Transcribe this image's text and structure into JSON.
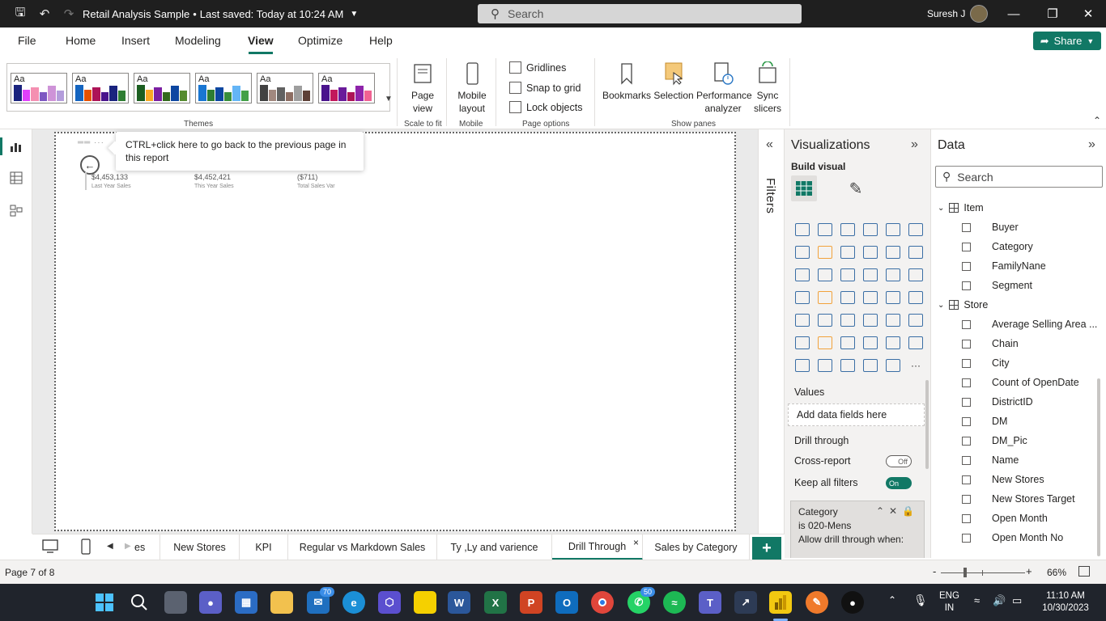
{
  "window": {
    "title": "Retail Analysis Sample",
    "saved_status": "Last saved: Today at 10:24 AM",
    "search_placeholder": "Search",
    "user_name": "Suresh J"
  },
  "menu": {
    "tabs": [
      "File",
      "Home",
      "Insert",
      "Modeling",
      "View",
      "Optimize",
      "Help"
    ],
    "active_tab": "View",
    "share_label": "Share"
  },
  "ribbon": {
    "themes_label": "Themes",
    "theme_aa": "Aa",
    "themes": [
      {
        "colors": [
          "#1a237e",
          "#e040fb",
          "#f48fb1",
          "#7e57c2",
          "#ce93d8",
          "#b39ddb"
        ]
      },
      {
        "colors": [
          "#1565c0",
          "#e65100",
          "#ad1457",
          "#4a148c",
          "#1a237e",
          "#2e7d32"
        ]
      },
      {
        "colors": [
          "#1b5e20",
          "#f9a825",
          "#7b1fa2",
          "#33691e",
          "#0d47a1",
          "#558b2f"
        ]
      },
      {
        "colors": [
          "#1976d2",
          "#2e7d32",
          "#0d47a1",
          "#388e3c",
          "#64b5f6",
          "#43a047"
        ]
      },
      {
        "colors": [
          "#424242",
          "#a1887f",
          "#616161",
          "#8d6e63",
          "#9e9e9e",
          "#5d4037"
        ]
      },
      {
        "colors": [
          "#4a148c",
          "#c2185b",
          "#6a1b9a",
          "#ad1457",
          "#8e24aa",
          "#f06292"
        ]
      }
    ],
    "page_view_label": "Page view",
    "scale_to_fit_label": "Scale to fit",
    "mobile_layout_label": "Mobile layout",
    "mobile_label": "Mobile",
    "gridlines_label": "Gridlines",
    "snap_to_grid_label": "Snap to grid",
    "lock_objects_label": "Lock objects",
    "page_options_label": "Page options",
    "bookmarks_label": "Bookmarks",
    "selection_label": "Selection",
    "performance_analyzer_label": "Performance analyzer",
    "sync_slicers_label": "Sync slicers",
    "show_panes_label": "Show panes"
  },
  "canvas": {
    "tooltip": "CTRL+click here to go back to the previous page in this report",
    "kpis": [
      {
        "value": "$4,453,133",
        "label": "Last Year Sales"
      },
      {
        "value": "$4,452,421",
        "label": "This Year Sales"
      },
      {
        "value": "($711)",
        "label": "Total Sales Var"
      }
    ]
  },
  "filters_label": "Filters",
  "visualizations": {
    "title": "Visualizations",
    "build_visual": "Build visual",
    "values_label": "Values",
    "add_fields_placeholder": "Add data fields here",
    "drill_through_label": "Drill through",
    "cross_report_label": "Cross-report",
    "cross_report_state": "Off",
    "keep_filters_label": "Keep all filters",
    "keep_filters_state": "On",
    "filter_card": {
      "field": "Category",
      "condition": "is 020-Mens",
      "allow": "Allow drill through when:"
    },
    "more_visuals": "···"
  },
  "data_pane": {
    "title": "Data",
    "search_placeholder": "Search",
    "tables": [
      {
        "name": "Item",
        "fields": [
          "Buyer",
          "Category",
          "FamilyNane",
          "Segment"
        ]
      },
      {
        "name": "Store",
        "fields": [
          "Average Selling Area ...",
          "Chain",
          "City",
          "Count of OpenDate",
          "DistrictID",
          "DM",
          "DM_Pic",
          "Name",
          "New Stores",
          "New Stores Target",
          "Open Month",
          "Open Month No"
        ]
      }
    ]
  },
  "page_tabs": {
    "partial_tab": "es",
    "tabs": [
      "New Stores",
      "KPI",
      "Regular vs Markdown Sales",
      "Ty ,Ly and varience",
      "Drill Through",
      "Sales by Category"
    ],
    "active": "Drill Through",
    "add_label": "+"
  },
  "status": {
    "page_indicator": "Page 7 of 8",
    "zoom_minus": "-",
    "zoom_plus": "+",
    "zoom": "66%"
  },
  "taskbar": {
    "badges": {
      "mail": "70",
      "whatsapp": "50"
    },
    "lang_primary": "ENG",
    "lang_secondary": "IN",
    "time": "11:10 AM",
    "date": "10/30/2023"
  }
}
